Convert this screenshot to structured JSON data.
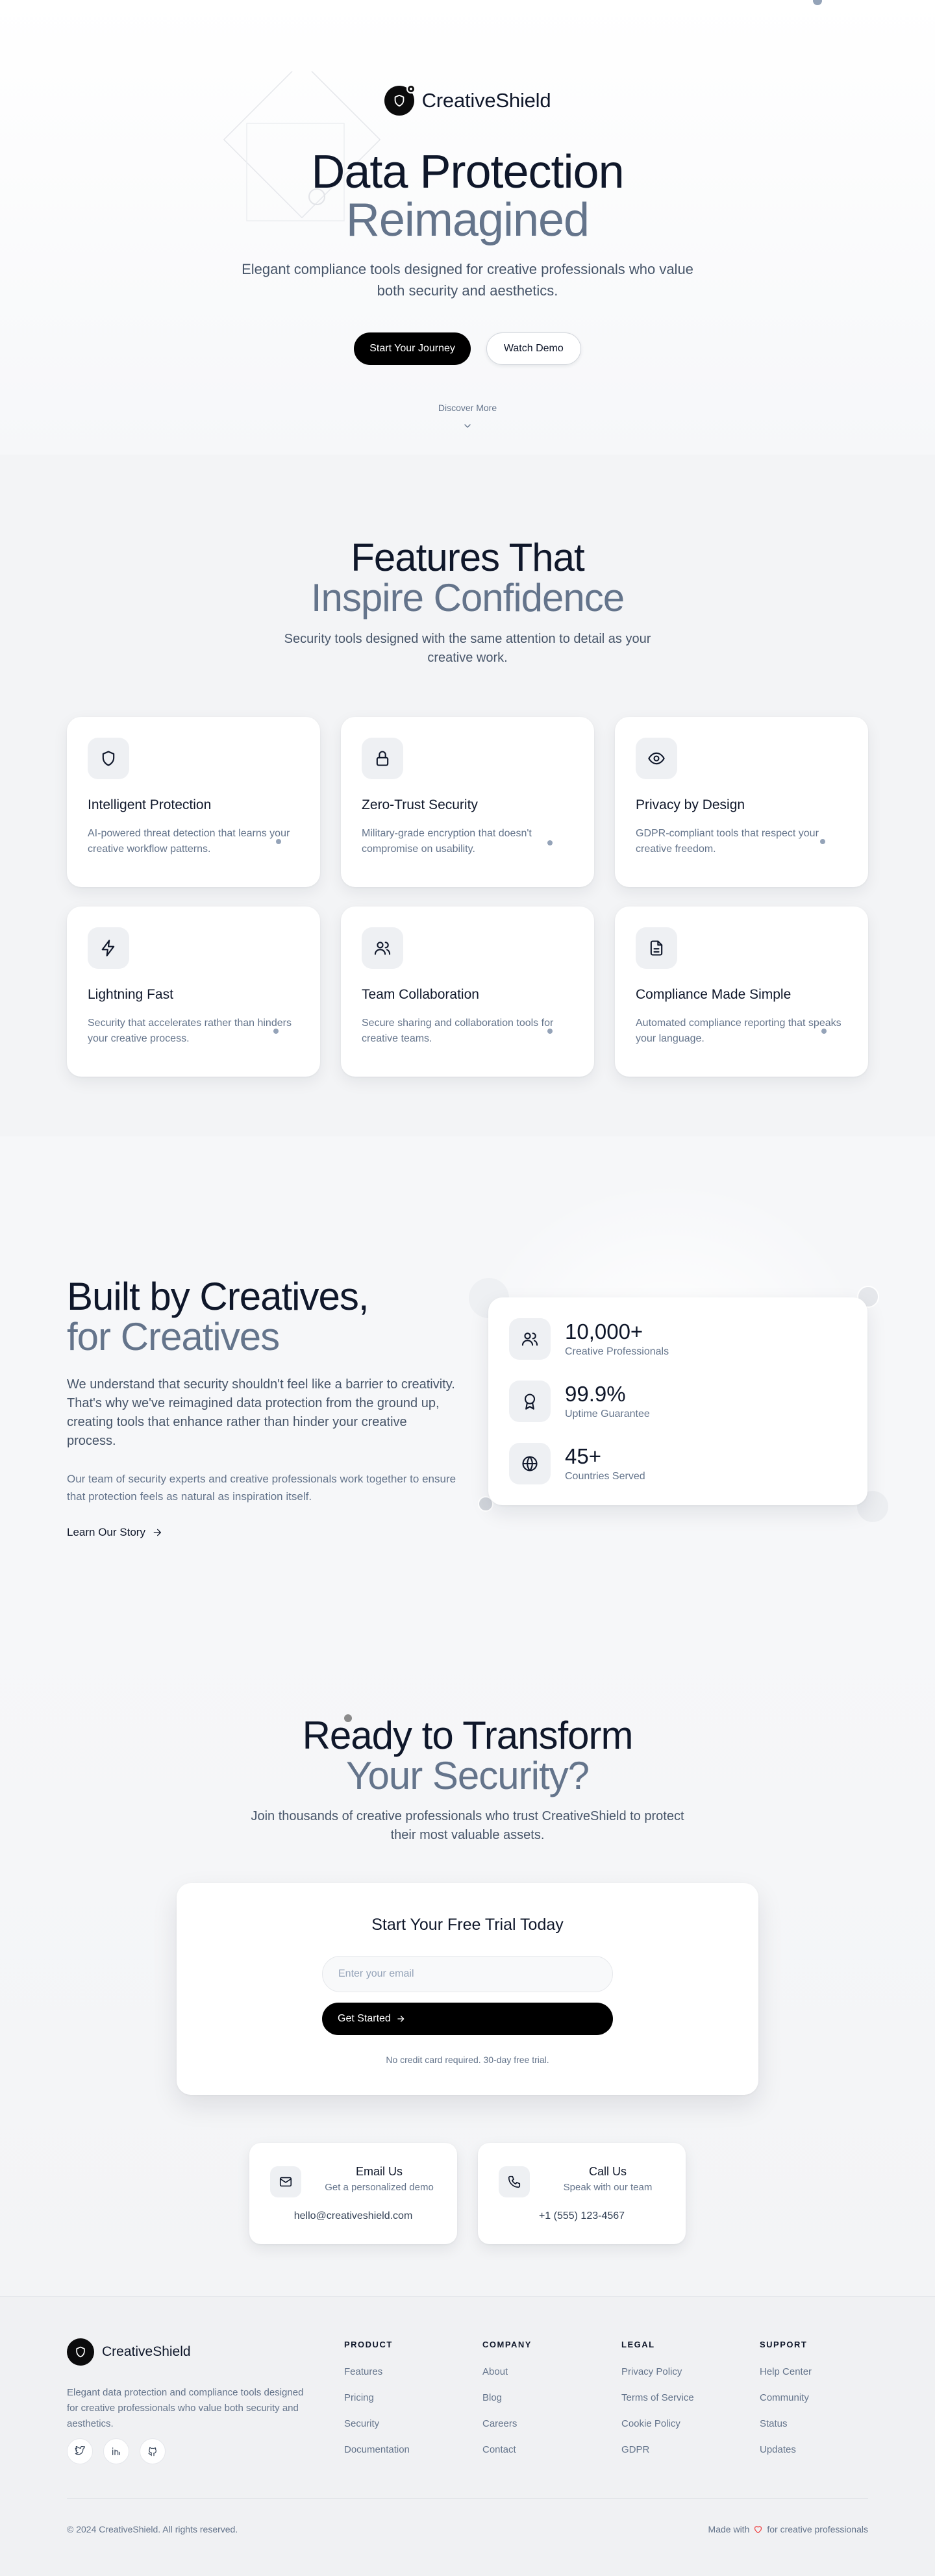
{
  "brand": {
    "name": "CreativeShield"
  },
  "hero": {
    "title_line1": "Data Protection",
    "title_line2": "Reimagined",
    "subtitle": "Elegant compliance tools designed for creative professionals who value both security and aesthetics.",
    "primary_button": "Start Your Journey",
    "secondary_button": "Watch Demo",
    "discover": "Discover More"
  },
  "features": {
    "title_line1": "Features That",
    "title_line2": "Inspire Confidence",
    "subtitle": "Security tools designed with the same attention to detail as your creative work.",
    "items": [
      {
        "icon": "shield-icon",
        "title": "Intelligent Protection",
        "desc": "AI-powered threat detection that learns your creative workflow patterns."
      },
      {
        "icon": "lock-icon",
        "title": "Zero-Trust Security",
        "desc": "Military-grade encryption that doesn't compromise on usability."
      },
      {
        "icon": "eye-icon",
        "title": "Privacy by Design",
        "desc": "GDPR-compliant tools that respect your creative freedom."
      },
      {
        "icon": "lightning-icon",
        "title": "Lightning Fast",
        "desc": "Security that accelerates rather than hinders your creative process."
      },
      {
        "icon": "users-icon",
        "title": "Team Collaboration",
        "desc": "Secure sharing and collaboration tools for creative teams."
      },
      {
        "icon": "document-icon",
        "title": "Compliance Made Simple",
        "desc": "Automated compliance reporting that speaks your language."
      }
    ]
  },
  "about": {
    "title_line1": "Built by Creatives,",
    "title_line2": "for Creatives",
    "paragraph1": "We understand that security shouldn't feel like a barrier to creativity. That's why we've reimagined data protection from the ground up, creating tools that enhance rather than hinder your creative process.",
    "paragraph2": "Our team of security experts and creative professionals work together to ensure that protection feels as natural as inspiration itself.",
    "link": "Learn Our Story",
    "stats": [
      {
        "icon": "users-icon",
        "value": "10,000+",
        "label": "Creative Professionals"
      },
      {
        "icon": "award-icon",
        "value": "99.9%",
        "label": "Uptime Guarantee"
      },
      {
        "icon": "globe-icon",
        "value": "45+",
        "label": "Countries Served"
      }
    ]
  },
  "cta": {
    "title_line1": "Ready to Transform",
    "title_line2": "Your Security?",
    "subtitle": "Join thousands of creative professionals who trust CreativeShield to protect their most valuable assets.",
    "card_title": "Start Your Free Trial Today",
    "email_placeholder": "Enter your email",
    "button": "Get Started",
    "note": "No credit card required. 30-day free trial.",
    "contacts": [
      {
        "icon": "mail-icon",
        "title": "Email Us",
        "subtitle": "Get a personalized demo",
        "value": "hello@creativeshield.com"
      },
      {
        "icon": "phone-icon",
        "title": "Call Us",
        "subtitle": "Speak with our team",
        "value": "+1 (555) 123-4567"
      }
    ]
  },
  "footer": {
    "brand": "CreativeShield",
    "description": "Elegant data protection and compliance tools designed for creative professionals who value both security and aesthetics.",
    "social": [
      "twitter-icon",
      "linkedin-icon",
      "github-icon"
    ],
    "columns": [
      {
        "title": "PRODUCT",
        "links": [
          "Features",
          "Pricing",
          "Security",
          "Documentation"
        ]
      },
      {
        "title": "COMPANY",
        "links": [
          "About",
          "Blog",
          "Careers",
          "Contact"
        ]
      },
      {
        "title": "LEGAL",
        "links": [
          "Privacy Policy",
          "Terms of Service",
          "Cookie Policy",
          "GDPR"
        ]
      },
      {
        "title": "SUPPORT",
        "links": [
          "Help Center",
          "Community",
          "Status",
          "Updates"
        ]
      }
    ],
    "copyright": "© 2024 CreativeShield. All rights reserved.",
    "made_with": "Made with",
    "made_for": "for creative professionals"
  },
  "colors": {
    "primary": "#000000",
    "muted": "#64748b",
    "heart": "#ef4444"
  }
}
